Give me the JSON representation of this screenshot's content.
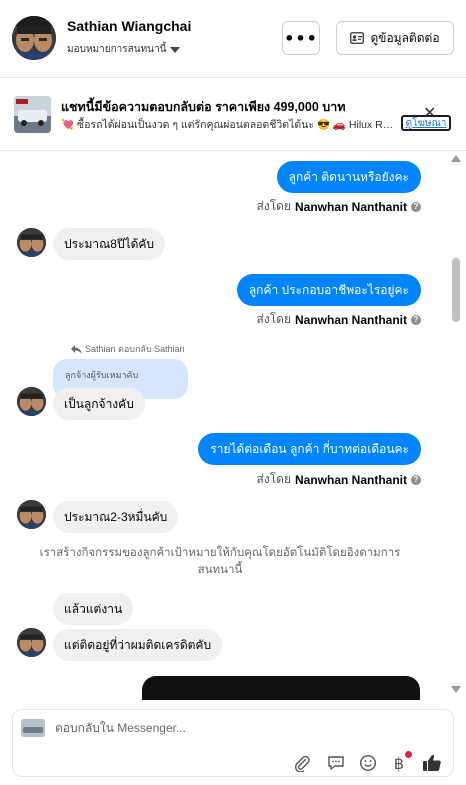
{
  "header": {
    "name": "Sathian Wiangchai",
    "assign_label": "มอบหมายการสนทนานี้",
    "more_label": "•••",
    "contact_button": "ดูข้อมูลติดต่อ"
  },
  "ad": {
    "title": "แชทนี้มีข้อความตอบกลับต่อ ราคาเพียง 499,000 บาท",
    "description": "💘 ซื้อรถได้ผ่อนเป็นงวด ๆ แต่รักคุณผ่อนตลอดชีวิตได้นะ 😎 🚗 Hilux Re...",
    "link": "ดูโฆษณา"
  },
  "messages": {
    "m1": "ลูกค้า ติดนานหรือยังคะ",
    "sent1_prefix": "ส่งโดย",
    "sent1_name": "Nanwhan Nanthanit",
    "m2": "ประมาณ8ปีได้คับ",
    "m3": "ลูกค้า ประกอบอาชีพอะไรอยู่คะ",
    "sent2_prefix": "ส่งโดย",
    "sent2_name": "Nanwhan Nanthanit",
    "reply_note": "Sathian ตอบกลับ Sathian",
    "quoted": "ลูกจ้างผู้รับเหมาคับ",
    "m4": "เป็นลูกจ้างคับ",
    "m5": "รายได้ต่อเดือน ลูกค้า  กี่บาทต่อเดือนคะ",
    "sent3_prefix": "ส่งโดย",
    "sent3_name": "Nanwhan Nanthanit",
    "m6": "ประมาณ2-3หมื่นคับ",
    "system_note": "เราสร้างกิจกรรมของลูกค้าเป้าหมายให้กับคุณโดยอัตโนมัติโดยอิงตามการสนทนานี้",
    "m7": "แล้วแต่งาน",
    "m8": "แต่ติดอยู่ที่ว่าผมติดเครดิตคับ"
  },
  "composer": {
    "placeholder": "ตอบกลับใน Messenger..."
  },
  "colors": {
    "outgoing": "#0084ff",
    "incoming": "#f0f0f0",
    "quoted": "#d6e6ff"
  }
}
